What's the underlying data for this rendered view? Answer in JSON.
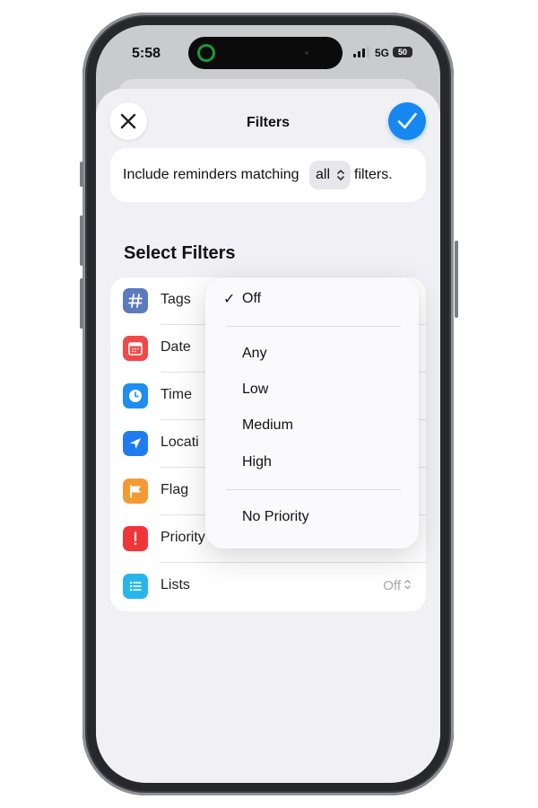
{
  "status": {
    "time": "5:58",
    "network": "5G",
    "battery": "50"
  },
  "header": {
    "title": "Filters",
    "close_icon": "close-icon",
    "done_icon": "checkmark-icon"
  },
  "include": {
    "prefix": "Include reminders matching",
    "selected": "all",
    "suffix": "filters."
  },
  "section": {
    "title": "Select Filters"
  },
  "filters": [
    {
      "label": "Tags",
      "icon": "hashtag-icon",
      "color": "#5b7bbd"
    },
    {
      "label": "Date",
      "icon": "calendar-icon",
      "color": "#f0494a"
    },
    {
      "label": "Time",
      "icon": "clock-icon",
      "color": "#1f8cf0"
    },
    {
      "label": "Locati",
      "icon": "location-arrow-icon",
      "color": "#1f7cf0"
    },
    {
      "label": "Flag",
      "icon": "flag-icon",
      "color": "#f49a33"
    },
    {
      "label": "Priority",
      "icon": "exclamation-icon",
      "color": "#f0353a"
    },
    {
      "label": "Lists",
      "icon": "list-icon",
      "color": "#28b6ea",
      "value": "Off"
    }
  ],
  "menu": {
    "items": [
      {
        "label": "Off",
        "checked": true
      },
      {
        "label": "Any"
      },
      {
        "label": "Low"
      },
      {
        "label": "Medium"
      },
      {
        "label": "High"
      },
      {
        "label": "No Priority"
      }
    ],
    "check_mark": "✓"
  },
  "colors": {
    "accent": "#1787f1",
    "sheet": "#f1f1f5",
    "card": "#ffffff"
  }
}
